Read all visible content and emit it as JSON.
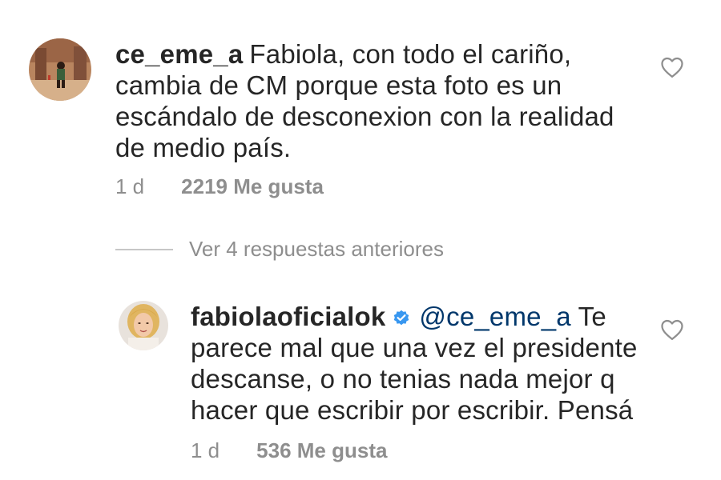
{
  "comments": [
    {
      "username": "ce_eme_a",
      "text": "Fabiola, con todo el cariño, cambia de CM porque esta foto es un escándalo de desconexion con la realidad de medio país.",
      "time": "1 d",
      "likes": "2219 Me gusta",
      "like_icon": "heart-outline-icon"
    }
  ],
  "replies_toggle": "Ver 4 respuestas anteriores",
  "reply": {
    "username": "fabiolaoficialok",
    "verified": true,
    "mention": "@ce_eme_a",
    "text": " Te parece mal que una vez el presidente descanse, o no tenias nada mejor q hacer que escribir por escribir. Pensá",
    "time": "1 d",
    "likes": "536 Me gusta",
    "like_icon": "heart-outline-icon"
  },
  "colors": {
    "text": "#262626",
    "secondary": "#8e8e8e",
    "mention": "#00376b",
    "verified": "#3897f0"
  }
}
